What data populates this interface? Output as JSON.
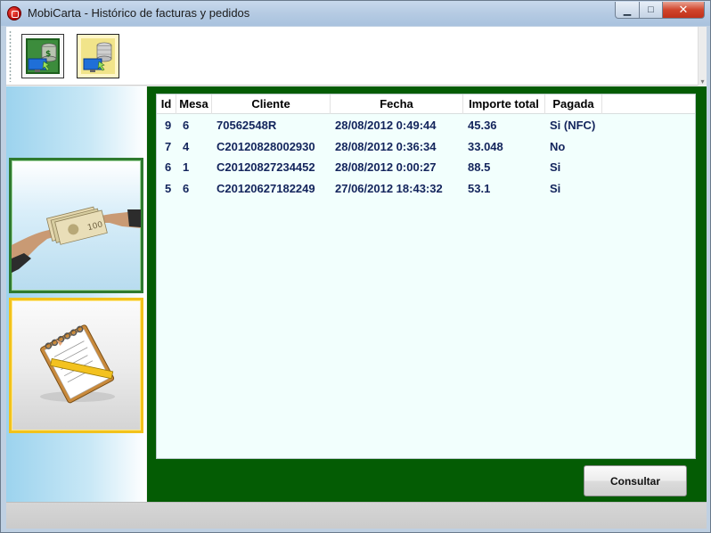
{
  "window": {
    "title": "MobiCarta - Histórico de facturas y pedidos",
    "minimize": "▁",
    "maximize": "□",
    "close": "✕"
  },
  "toolbar": {
    "buttons": [
      {
        "name": "money-to-screen-icon",
        "active": false
      },
      {
        "name": "database-to-screen-icon",
        "active": true
      }
    ]
  },
  "nav": {
    "tiles": [
      {
        "name": "payment-hands-icon",
        "selected": true
      },
      {
        "name": "notepad-pencil-icon",
        "selected": false
      }
    ]
  },
  "grid": {
    "columns": [
      "Id",
      "Mesa",
      "Cliente",
      "Fecha",
      "Importe total",
      "Pagada"
    ],
    "rows": [
      {
        "id": "9",
        "mesa": "6",
        "cliente": "70562548R",
        "fecha": "28/08/2012 0:49:44",
        "importe": "45.36",
        "pagada": "Si (NFC)"
      },
      {
        "id": "7",
        "mesa": "4",
        "cliente": "C20120828002930",
        "fecha": "28/08/2012 0:36:34",
        "importe": "33.048",
        "pagada": "No"
      },
      {
        "id": "6",
        "mesa": "1",
        "cliente": "C20120827234452",
        "fecha": "28/08/2012 0:00:27",
        "importe": "88.5",
        "pagada": "Si"
      },
      {
        "id": "5",
        "mesa": "6",
        "cliente": "C20120627182249",
        "fecha": "27/06/2012 18:43:32",
        "importe": "53.1",
        "pagada": "Si"
      }
    ]
  },
  "actions": {
    "consultar": "Consultar"
  },
  "colors": {
    "main_panel": "#045c04",
    "grid_bg": "#f2fffd",
    "row_text": "#13245c",
    "tile_selected_border": "#2f7a2f",
    "tile_other_border": "#f2c21c"
  }
}
